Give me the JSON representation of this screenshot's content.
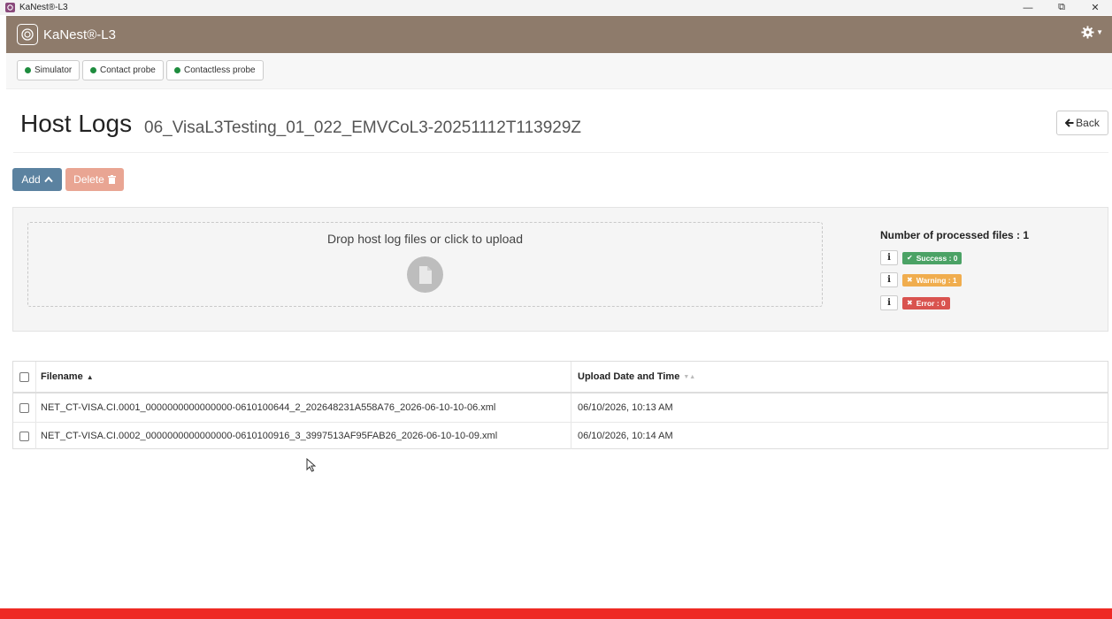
{
  "window": {
    "title": "KaNest®-L3",
    "controls": {
      "minimize": "—",
      "restore": "⧉",
      "close": "✕"
    }
  },
  "header": {
    "brand": "KaNest®-L3",
    "settings_icon": "gear-icon"
  },
  "probes": [
    {
      "label": "Simulator",
      "status_color": "#1e8c3e"
    },
    {
      "label": "Contact probe",
      "status_color": "#1e8c3e"
    },
    {
      "label": "Contactless probe",
      "status_color": "#1e8c3e"
    }
  ],
  "page": {
    "title": "Host Logs",
    "subtitle": "06_VisaL3Testing_01_022_EMVCoL3-20251112T113929Z",
    "back_label": "Back"
  },
  "actions": {
    "add_label": "Add",
    "delete_label": "Delete"
  },
  "upload": {
    "drop_text": "Drop host log files or click to upload",
    "stats_title": "Number of processed files : 1",
    "info_label": "i",
    "success_label": "Success : 0",
    "warning_label": "Warning : 1",
    "error_label": "Error : 0"
  },
  "table": {
    "columns": {
      "filename": "Filename",
      "upload_date": "Upload Date and Time"
    },
    "rows": [
      {
        "filename": "NET_CT-VISA.CI.0001_0000000000000000-0610100644_2_202648231A558A76_2026-06-10-10-06.xml",
        "upload_date": "06/10/2026, 10:13 AM"
      },
      {
        "filename": "NET_CT-VISA.CI.0002_0000000000000000-0610100916_3_3997513AF95FAB26_2026-06-10-10-09.xml",
        "upload_date": "06/10/2026, 10:14 AM"
      }
    ]
  },
  "colors": {
    "header_bg": "#8e7b6b",
    "add_button": "#5b82a0",
    "delete_button": "#e9a593",
    "success": "#4ba265",
    "warning": "#f0ad4e",
    "error": "#d9534f",
    "bottom_bar": "#ee2a24"
  }
}
